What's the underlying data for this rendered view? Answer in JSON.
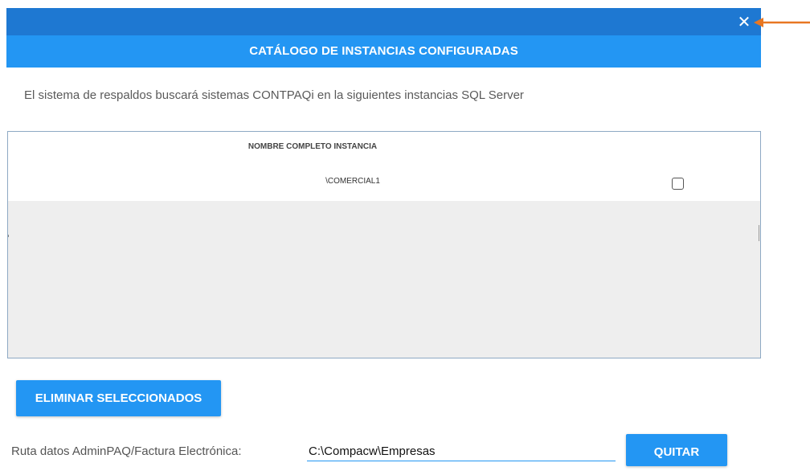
{
  "window": {
    "close_glyph": "✕"
  },
  "header": {
    "title": "CATÁLOGO DE INSTANCIAS CONFIGURADAS"
  },
  "description": "El sistema de respaldos buscará sistemas CONTPAQi en la siguientes instancias SQL Server",
  "table": {
    "columns": [
      "NOMBRE COMPLETO INSTANCIA"
    ],
    "rows": [
      {
        "instance": "\\COMERCIAL1",
        "selected": false
      }
    ]
  },
  "buttons": {
    "delete_selected": "ELIMINAR SELECCIONADOS",
    "remove": "QUITAR"
  },
  "path": {
    "label": "Ruta datos AdminPAQ/Factura Electrónica:",
    "value": "C:\\Compacw\\Empresas"
  },
  "annotation": {
    "arrow_color": "#e87722"
  },
  "colors": {
    "titlebar": "#1e78d2",
    "accent": "#2396f3"
  }
}
